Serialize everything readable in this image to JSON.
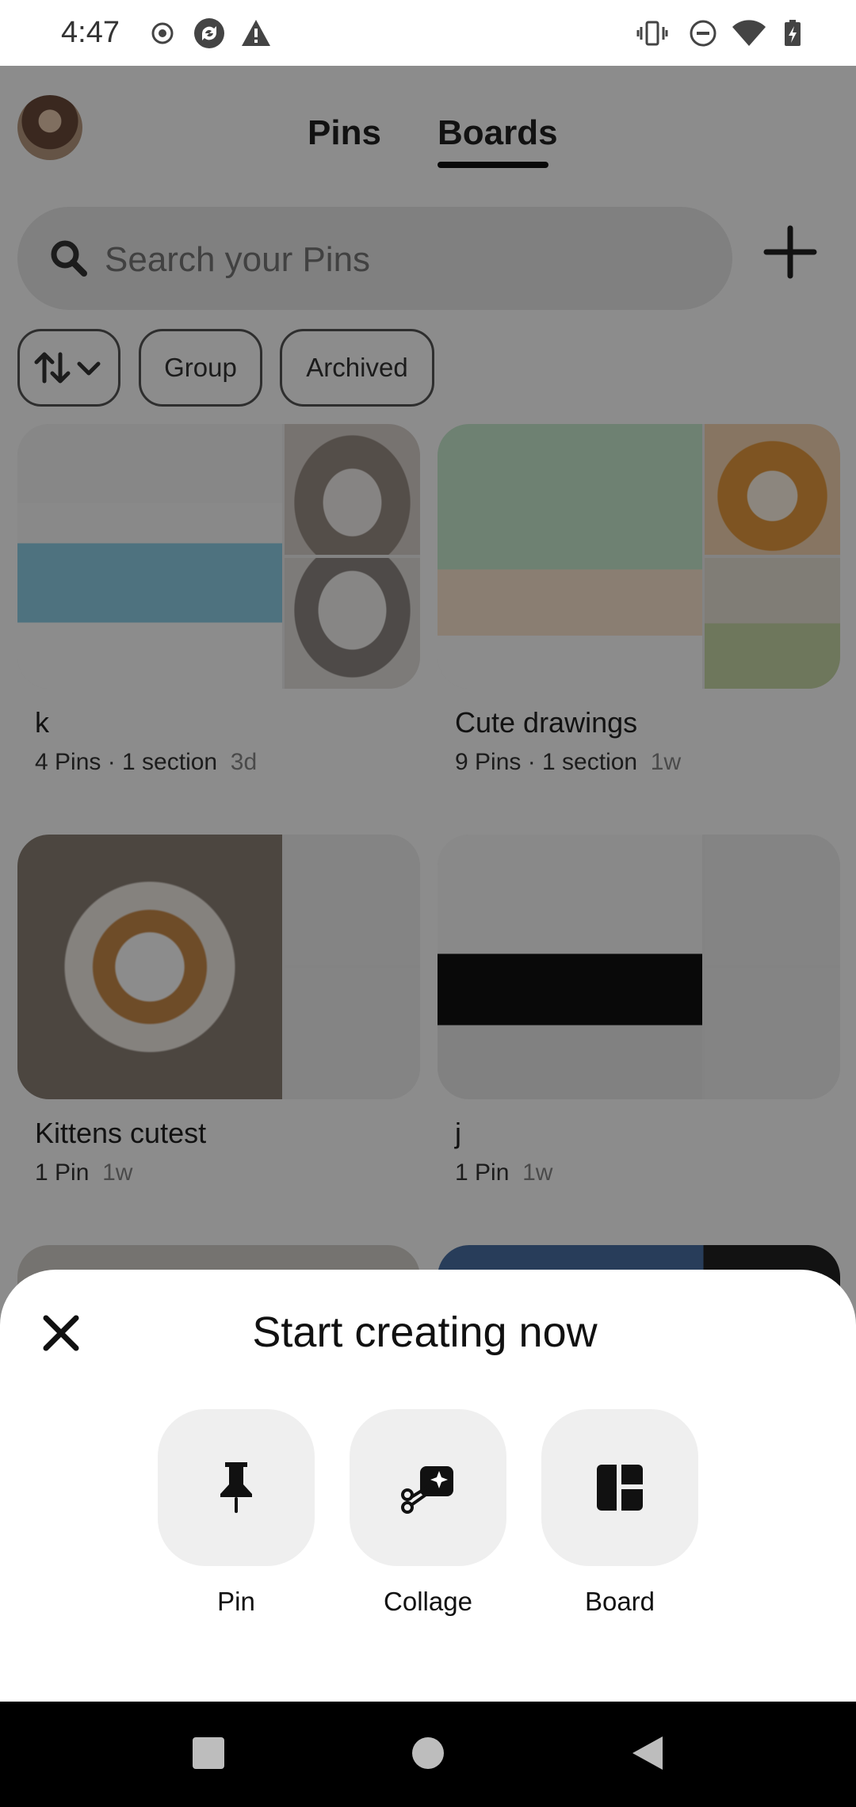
{
  "status_bar": {
    "time": "4:47",
    "left_icons": [
      "record-icon",
      "sync-icon",
      "warning-icon"
    ],
    "right_icons": [
      "vibrate-icon",
      "do-not-disturb-icon",
      "wifi-icon",
      "battery-charging-icon"
    ]
  },
  "header": {
    "tabs": [
      {
        "label": "Pins",
        "selected": false
      },
      {
        "label": "Boards",
        "selected": true
      }
    ]
  },
  "search": {
    "placeholder": "Search your Pins"
  },
  "filters": {
    "chips": [
      {
        "label": "Group"
      },
      {
        "label": "Archived"
      }
    ]
  },
  "boards": [
    {
      "name": "k",
      "meta": "4 Pins · 1 section",
      "age": "3d"
    },
    {
      "name": "Cute drawings",
      "meta": "9 Pins · 1 section",
      "age": "1w"
    },
    {
      "name": "Kittens cutest",
      "meta": "1 Pin",
      "age": "1w"
    },
    {
      "name": "j",
      "meta": "1 Pin",
      "age": "1w"
    }
  ],
  "sheet": {
    "title": "Start creating now",
    "options": [
      {
        "label": "Pin",
        "icon": "pushpin-icon"
      },
      {
        "label": "Collage",
        "icon": "collage-scissors-icon"
      },
      {
        "label": "Board",
        "icon": "board-layout-icon"
      }
    ]
  },
  "colors": {
    "overlay": "#000000",
    "sheet_background": "#ffffff",
    "option_background": "#efefef"
  }
}
